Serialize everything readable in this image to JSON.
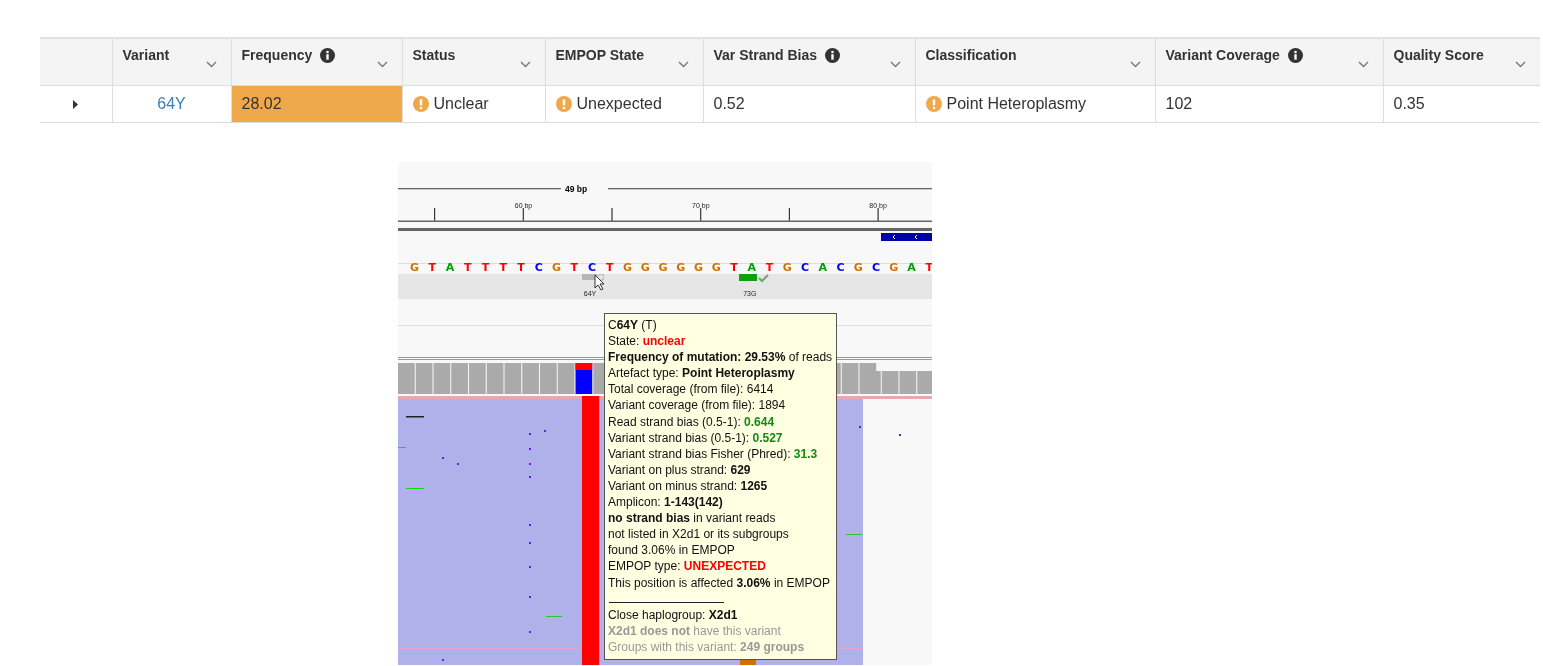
{
  "table": {
    "columns": [
      {
        "label": "Variant",
        "info": false,
        "sortable": true
      },
      {
        "label": "Frequency",
        "info": true,
        "sortable": true
      },
      {
        "label": "Status",
        "info": false,
        "sortable": true
      },
      {
        "label": "EMPOP State",
        "info": false,
        "sortable": true
      },
      {
        "label": "Var Strand Bias",
        "info": true,
        "sortable": true
      },
      {
        "label": "Classification",
        "info": false,
        "sortable": true
      },
      {
        "label": "Variant Coverage",
        "info": true,
        "sortable": true
      },
      {
        "label": "Quality Score",
        "info": false,
        "sortable": true
      }
    ],
    "rows": [
      {
        "expanded": false,
        "cells": [
          {
            "kind": "link",
            "text": "64Y"
          },
          {
            "kind": "highlight",
            "text": "28.02"
          },
          {
            "kind": "warning",
            "text": "Unclear"
          },
          {
            "kind": "warning",
            "text": "Unexpected"
          },
          {
            "kind": "plain",
            "text": "0.52"
          },
          {
            "kind": "warning",
            "text": "Point Heteroplasmy"
          },
          {
            "kind": "plain",
            "text": "102"
          },
          {
            "kind": "plain",
            "text": "0.35"
          }
        ]
      }
    ]
  },
  "viewer": {
    "span": "49 bp",
    "ticks": [
      "60 bp",
      "70 bp",
      "80 bp"
    ],
    "bases": [
      {
        "base": "G",
        "color": "#d17105"
      },
      {
        "base": "T",
        "color": "#ff0000"
      },
      {
        "base": "A",
        "color": "#00a000"
      },
      {
        "base": "T",
        "color": "#ff0000"
      },
      {
        "base": "T",
        "color": "#ff0000"
      },
      {
        "base": "T",
        "color": "#ff0000"
      },
      {
        "base": "T",
        "color": "#ff0000"
      },
      {
        "base": "C",
        "color": "#0000ff"
      },
      {
        "base": "G",
        "color": "#d17105"
      },
      {
        "base": "T",
        "color": "#ff0000"
      },
      {
        "base": "C",
        "color": "#0000ff"
      },
      {
        "base": "T",
        "color": "#ff0000"
      },
      {
        "base": "G",
        "color": "#d17105"
      },
      {
        "base": "G",
        "color": "#d17105"
      },
      {
        "base": "G",
        "color": "#d17105"
      },
      {
        "base": "G",
        "color": "#d17105"
      },
      {
        "base": "G",
        "color": "#d17105"
      },
      {
        "base": "G",
        "color": "#d17105"
      },
      {
        "base": "T",
        "color": "#ff0000"
      },
      {
        "base": "A",
        "color": "#00a000"
      },
      {
        "base": "T",
        "color": "#ff0000"
      },
      {
        "base": "G",
        "color": "#d17105"
      },
      {
        "base": "C",
        "color": "#0000ff"
      },
      {
        "base": "A",
        "color": "#00a000"
      },
      {
        "base": "C",
        "color": "#0000ff"
      },
      {
        "base": "G",
        "color": "#d17105"
      },
      {
        "base": "C",
        "color": "#0000ff"
      },
      {
        "base": "G",
        "color": "#d17105"
      },
      {
        "base": "A",
        "color": "#00a000"
      },
      {
        "base": "T",
        "color": "#ff0000"
      }
    ],
    "variants": [
      {
        "label": "64Y",
        "kind": "unclear"
      },
      {
        "label": "73G",
        "kind": "confirmed"
      }
    ],
    "tooltip": [
      [
        {
          "kind": "plain",
          "text": "C"
        },
        {
          "kind": "bold",
          "text": "64Y"
        },
        {
          "kind": "plain",
          "text": " (T)"
        }
      ],
      [
        {
          "kind": "plain",
          "text": "State: "
        },
        {
          "kind": "alert",
          "text": "unclear"
        }
      ],
      [
        {
          "kind": "bold",
          "text": "Frequency of mutation: 29.53%"
        },
        {
          "kind": "plain",
          "text": " of reads"
        }
      ],
      [
        {
          "kind": "plain",
          "text": "Artefact type: "
        },
        {
          "kind": "bold",
          "text": "Point Heteroplasmy"
        }
      ],
      [
        {
          "kind": "plain",
          "text": "Total coverage (from file): 6414"
        }
      ],
      [
        {
          "kind": "plain",
          "text": "Variant coverage (from file): 1894"
        }
      ],
      [
        {
          "kind": "plain",
          "text": "Read strand bias (0.5-1): "
        },
        {
          "kind": "good",
          "text": "0.644"
        }
      ],
      [
        {
          "kind": "plain",
          "text": "Variant strand bias (0.5-1): "
        },
        {
          "kind": "good",
          "text": "0.527"
        }
      ],
      [
        {
          "kind": "plain",
          "text": "Variant strand bias Fisher (Phred): "
        },
        {
          "kind": "good",
          "text": "31.3"
        }
      ],
      [
        {
          "kind": "plain",
          "text": "Variant on plus strand: "
        },
        {
          "kind": "bold",
          "text": "629"
        }
      ],
      [
        {
          "kind": "plain",
          "text": "Variant on minus strand: "
        },
        {
          "kind": "bold",
          "text": "1265"
        }
      ],
      [
        {
          "kind": "plain",
          "text": "Amplicon: "
        },
        {
          "kind": "bold",
          "text": "1-143(142)"
        }
      ],
      [
        {
          "kind": "bold",
          "text": "no strand bias"
        },
        {
          "kind": "plain",
          "text": " in variant reads"
        }
      ],
      [
        {
          "kind": "plain",
          "text": "not listed in X2d1 or its subgroups"
        }
      ],
      [
        {
          "kind": "plain",
          "text": "found 3.06% in EMPOP"
        }
      ],
      [
        {
          "kind": "plain",
          "text": "EMPOP type: "
        },
        {
          "kind": "alert",
          "text": "UNEXPECTED"
        }
      ],
      [
        {
          "kind": "plain",
          "text": "This position is affected "
        },
        {
          "kind": "bold",
          "text": "3.06%"
        },
        {
          "kind": "plain",
          "text": " in EMPOP"
        }
      ],
      [
        {
          "kind": "rule"
        }
      ],
      [
        {
          "kind": "plain",
          "text": "Close haplogroup: "
        },
        {
          "kind": "bold",
          "text": "X2d1"
        }
      ],
      [
        {
          "kind": "muted-bold",
          "text": "X2d1 does not"
        },
        {
          "kind": "muted",
          "text": " have this variant"
        }
      ],
      [
        {
          "kind": "muted",
          "text": "Groups with this variant: "
        },
        {
          "kind": "muted-bold",
          "text": "249 groups"
        }
      ]
    ]
  }
}
